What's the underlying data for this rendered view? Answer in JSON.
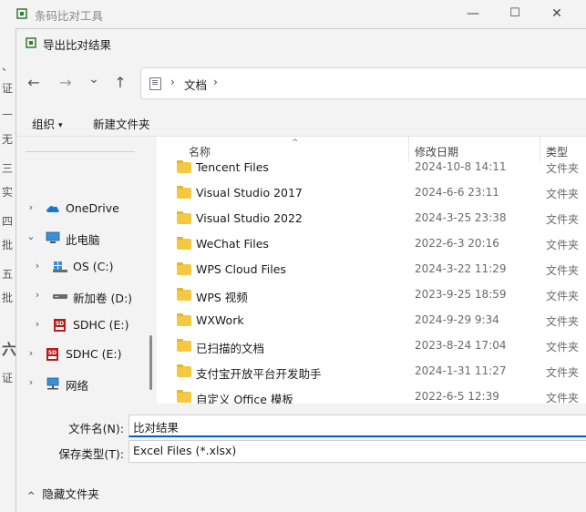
{
  "parent_window": {
    "title": "条码比对工具",
    "side_chars": [
      "、",
      "证",
      "—",
      "无",
      "三",
      "实",
      "四",
      "批",
      "五",
      "批",
      "六",
      "证"
    ],
    "controls": {
      "minimize": "—",
      "maximize": "☐",
      "close": "✕"
    }
  },
  "dialog": {
    "title": "导出比对结果",
    "navigation": {
      "back": "←",
      "forward": "→",
      "recent": "⌄",
      "up": "↑"
    },
    "address": {
      "separator": "›",
      "crumb": "文档"
    },
    "commands": {
      "organize": "组织",
      "organize_caret": "▾",
      "new_folder": "新建文件夹"
    },
    "tree": [
      {
        "label": "OneDrive",
        "icon": "cloud-icon",
        "chevron": "›"
      },
      {
        "label": "此电脑",
        "icon": "computer-icon",
        "chevron": "⌄"
      },
      {
        "label": "OS (C:)",
        "icon": "drive-icon",
        "chevron": "›"
      },
      {
        "label": "新加卷 (D:)",
        "icon": "drive-icon",
        "chevron": "›"
      },
      {
        "label": "SDHC (E:)",
        "icon": "sd-card-icon",
        "chevron": "›"
      },
      {
        "label": "SDHC (E:)",
        "icon": "sd-card-icon",
        "chevron": "›"
      },
      {
        "label": "网络",
        "icon": "network-icon",
        "chevron": "›"
      }
    ],
    "columns": {
      "name": "名称",
      "date": "修改日期",
      "type": "类型",
      "sort_arrow": "^"
    },
    "files": [
      {
        "name": "Tencent Files",
        "date": "2024-10-8 14:11",
        "type": "文件夹"
      },
      {
        "name": "Visual Studio 2017",
        "date": "2024-6-6 23:11",
        "type": "文件夹"
      },
      {
        "name": "Visual Studio 2022",
        "date": "2024-3-25 23:38",
        "type": "文件夹"
      },
      {
        "name": "WeChat Files",
        "date": "2022-6-3 20:16",
        "type": "文件夹"
      },
      {
        "name": "WPS Cloud Files",
        "date": "2024-3-22 11:29",
        "type": "文件夹"
      },
      {
        "name": "WPS 视频",
        "date": "2023-9-25 18:59",
        "type": "文件夹"
      },
      {
        "name": "WXWork",
        "date": "2024-9-29 9:34",
        "type": "文件夹"
      },
      {
        "name": "已扫描的文档",
        "date": "2023-8-24 17:04",
        "type": "文件夹"
      },
      {
        "name": "支付宝开放平台开发助手",
        "date": "2024-1-31 11:27",
        "type": "文件夹"
      },
      {
        "name": "自定义 Office 模板",
        "date": "2022-6-5 12:39",
        "type": "文件夹"
      }
    ],
    "filename": {
      "label": "文件名(N):",
      "value": "比对结果"
    },
    "filetype": {
      "label": "保存类型(T):",
      "value": "Excel Files (*.xlsx)"
    },
    "hide_folders": {
      "chevron": "^",
      "label": "隐藏文件夹"
    }
  }
}
